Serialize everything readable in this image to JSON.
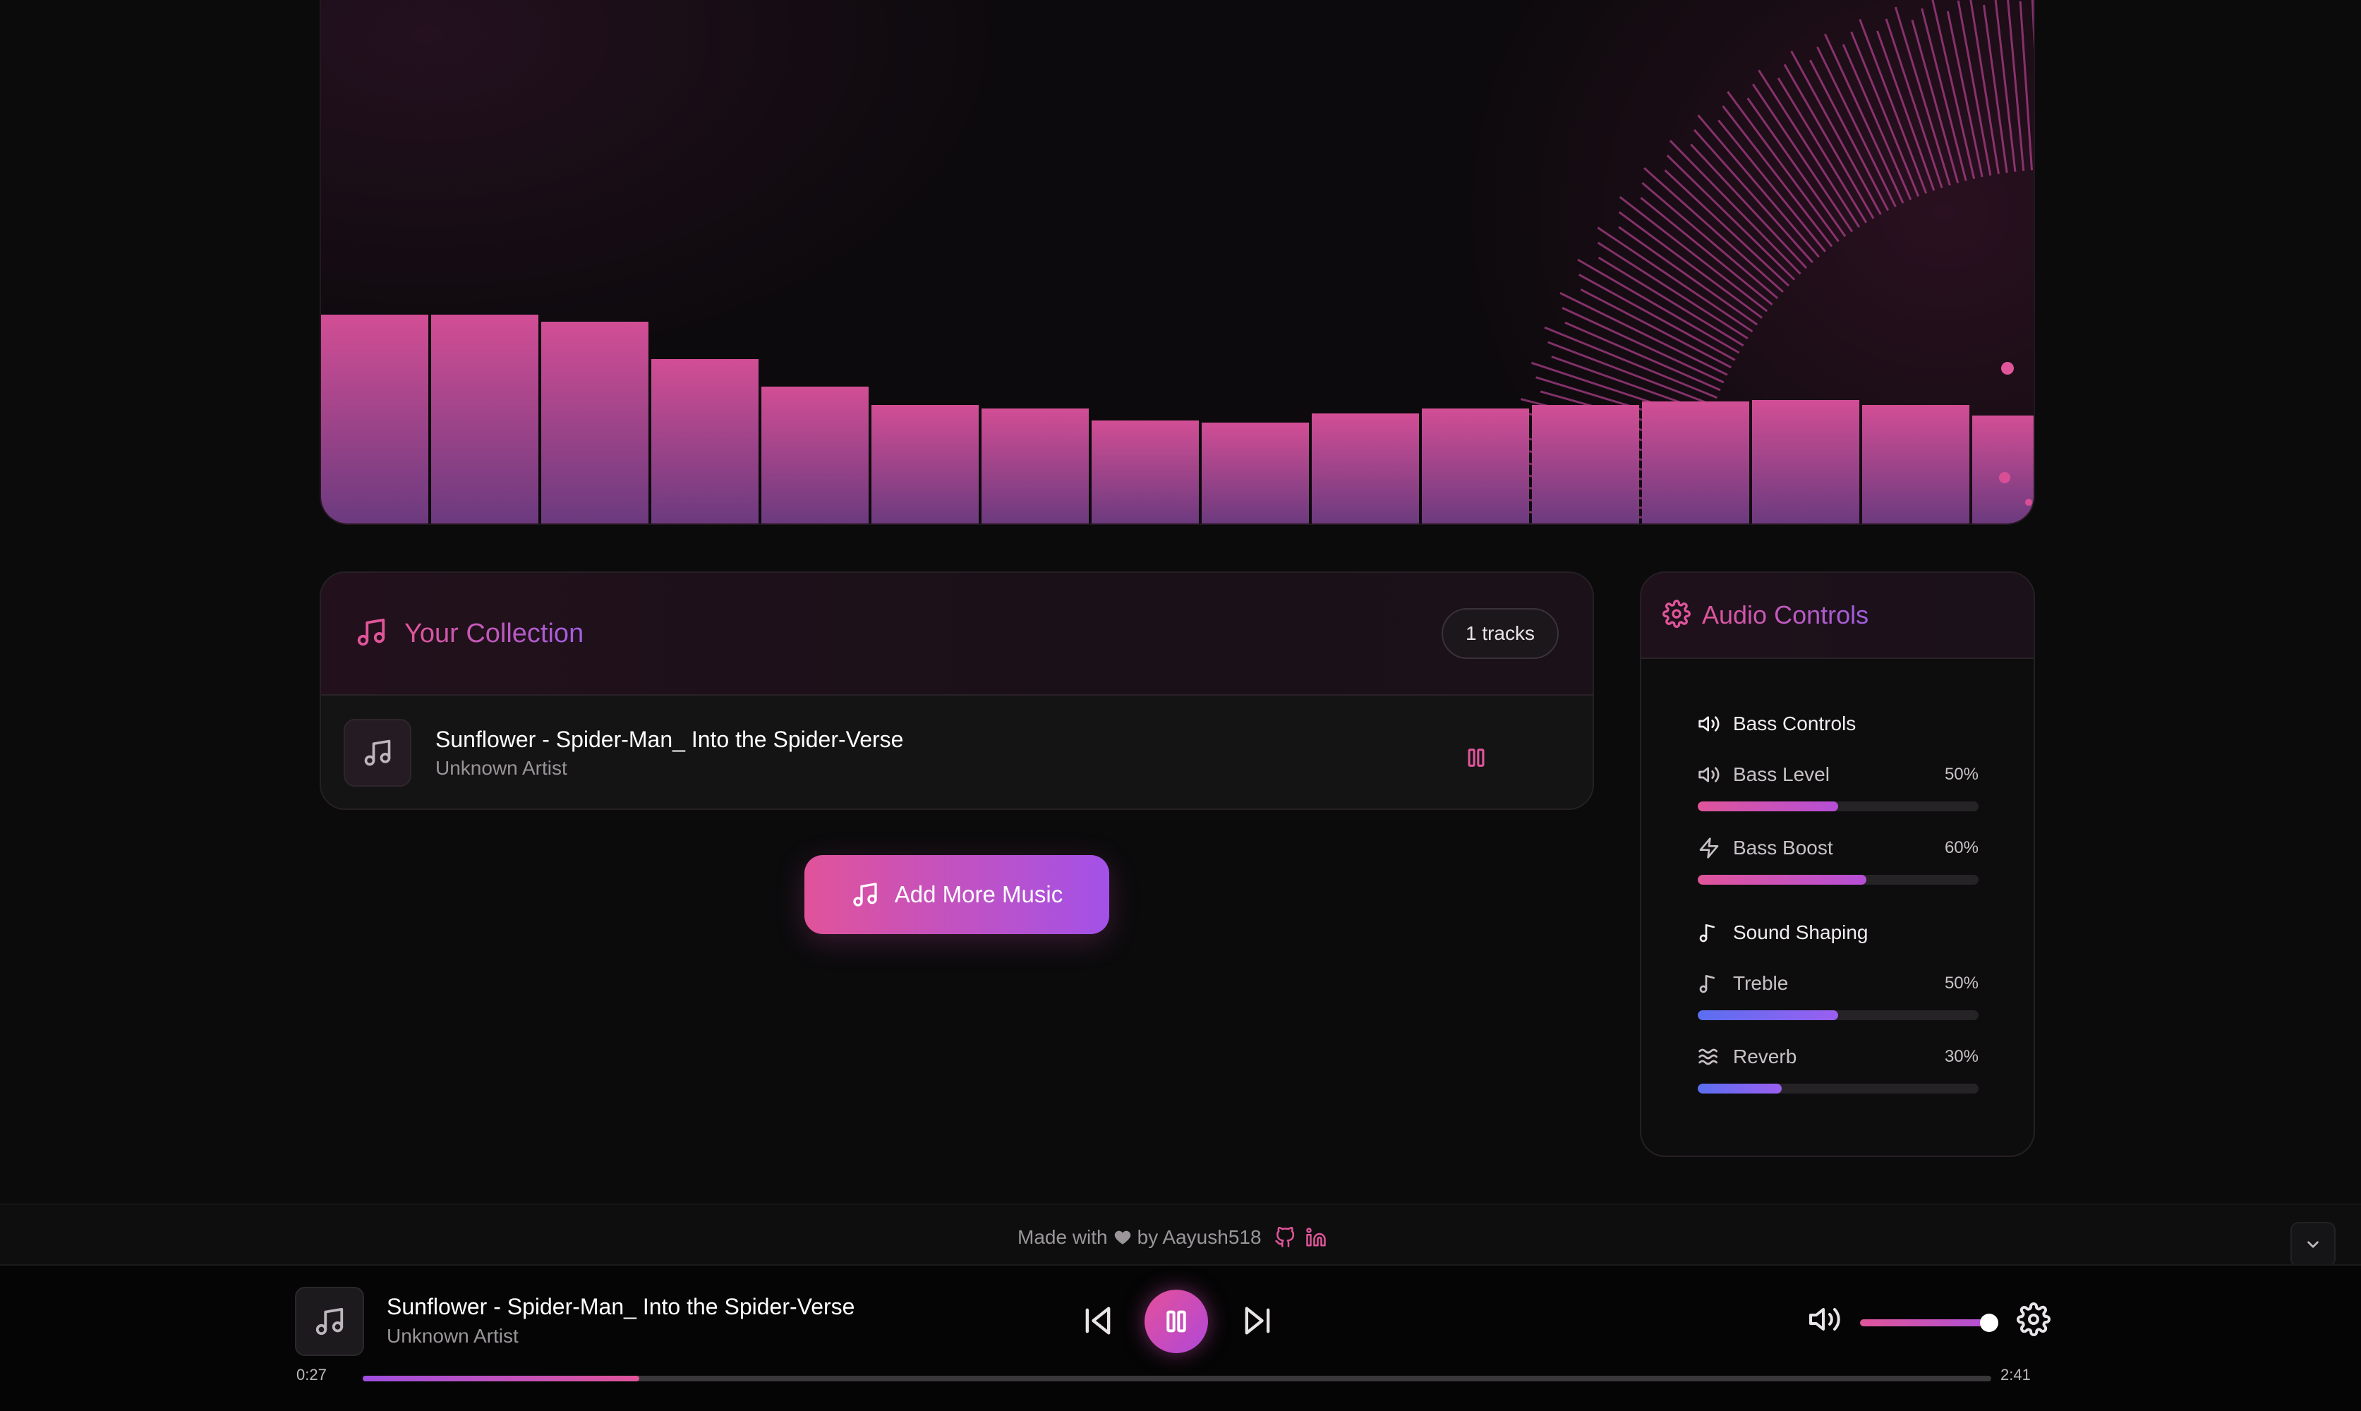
{
  "visualizer": {
    "bar_levels": [
      0.298,
      0.298,
      0.288,
      0.235,
      0.196,
      0.17,
      0.165,
      0.148,
      0.145,
      0.158,
      0.165,
      0.17,
      0.175,
      0.177,
      0.17,
      0.155
    ],
    "colors": {
      "bar_top": "#cf4c92",
      "bar_bottom": "#6a3a7d",
      "rays": "#c0479a"
    }
  },
  "collection": {
    "title": "Your Collection",
    "count_badge": "1 tracks",
    "tracks": [
      {
        "title": "Sunflower - Spider-Man_ Into the Spider-Verse",
        "artist": "Unknown Artist"
      }
    ]
  },
  "add_button": {
    "label": "Add More Music"
  },
  "audio_controls": {
    "title": "Audio Controls",
    "bass_section": "Bass Controls",
    "bass_level": {
      "label": "Bass Level",
      "value_text": "50%",
      "value": 0.5
    },
    "bass_boost": {
      "label": "Bass Boost",
      "value_text": "60%",
      "value": 0.6
    },
    "shaping_section": "Sound Shaping",
    "treble": {
      "label": "Treble",
      "value_text": "50%",
      "value": 0.5
    },
    "reverb": {
      "label": "Reverb",
      "value_text": "30%",
      "value": 0.3
    }
  },
  "footer": {
    "made_with": "Made with",
    "by": "by Aayush518",
    "icons": [
      "heart-icon",
      "github-icon",
      "linkedin-icon"
    ]
  },
  "player": {
    "title": "Sunflower - Spider-Man_ Into the Spider-Verse",
    "artist": "Unknown Artist",
    "elapsed": "0:27",
    "duration": "2:41",
    "progress": 0.17,
    "volume": 0.93
  },
  "theme": {
    "accent_pink": "#e0559a",
    "accent_purple": "#a351e8",
    "accent_blue": "#5a6ff0",
    "background": "#0b0b0c"
  }
}
